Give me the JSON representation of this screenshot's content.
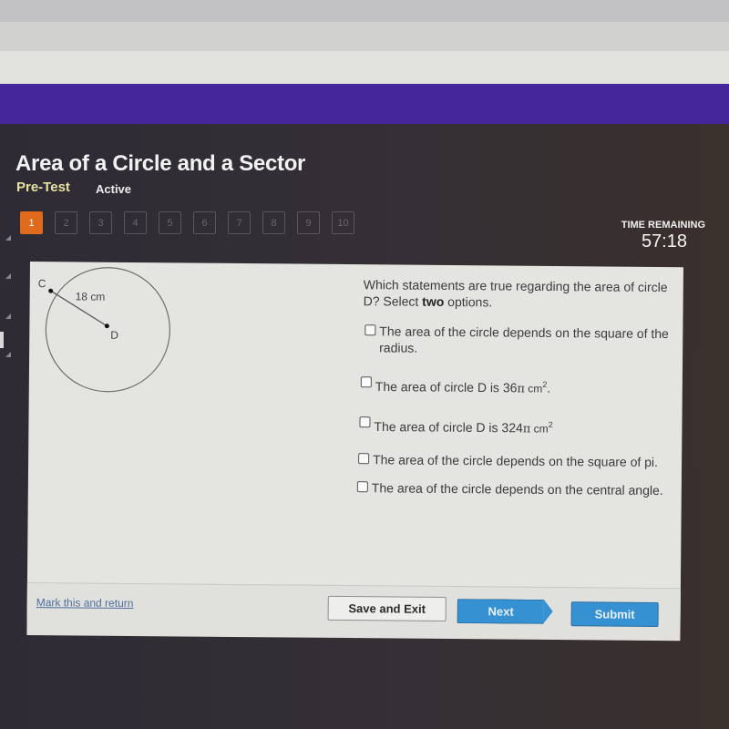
{
  "header": {
    "title": "Area of a Circle and a Sector",
    "mode": "Pre-Test",
    "status": "Active"
  },
  "question_nav": {
    "items": [
      "1",
      "2",
      "3",
      "4",
      "5",
      "6",
      "7",
      "8",
      "9",
      "10"
    ],
    "active": "1"
  },
  "timer": {
    "label": "TIME REMAINING",
    "value": "57:18"
  },
  "diagram": {
    "point_edge": "C",
    "point_center": "D",
    "radius_label": "18 cm"
  },
  "question": {
    "text_before": "Which statements are true regarding the area of circle D? Select ",
    "emphasis": "two",
    "text_after": " options."
  },
  "options": [
    {
      "text": "The area of the circle depends on the square of the radius.",
      "checked": false
    },
    {
      "text_prefix": "The area of circle D is 36",
      "pi": "π",
      "unit": " cm",
      "exp": "2",
      "suffix": ".",
      "checked": false
    },
    {
      "text_prefix": "The area of circle D is 324",
      "pi": "π",
      "unit": " cm",
      "exp": "2",
      "suffix": "",
      "checked": false
    },
    {
      "text": "The area of the circle depends on the square of pi.",
      "checked": false
    },
    {
      "text": "The area of the circle depends on the central angle.",
      "checked": false
    }
  ],
  "footer": {
    "mark_link": "Mark this and return",
    "save_label": "Save and Exit",
    "next_label": "Next",
    "submit_label": "Submit"
  },
  "colors": {
    "accent_purple": "#45279a",
    "active_question": "#e06a1c",
    "button_blue": "#3591d1",
    "subtitle_yellow": "#e8e2a0"
  }
}
